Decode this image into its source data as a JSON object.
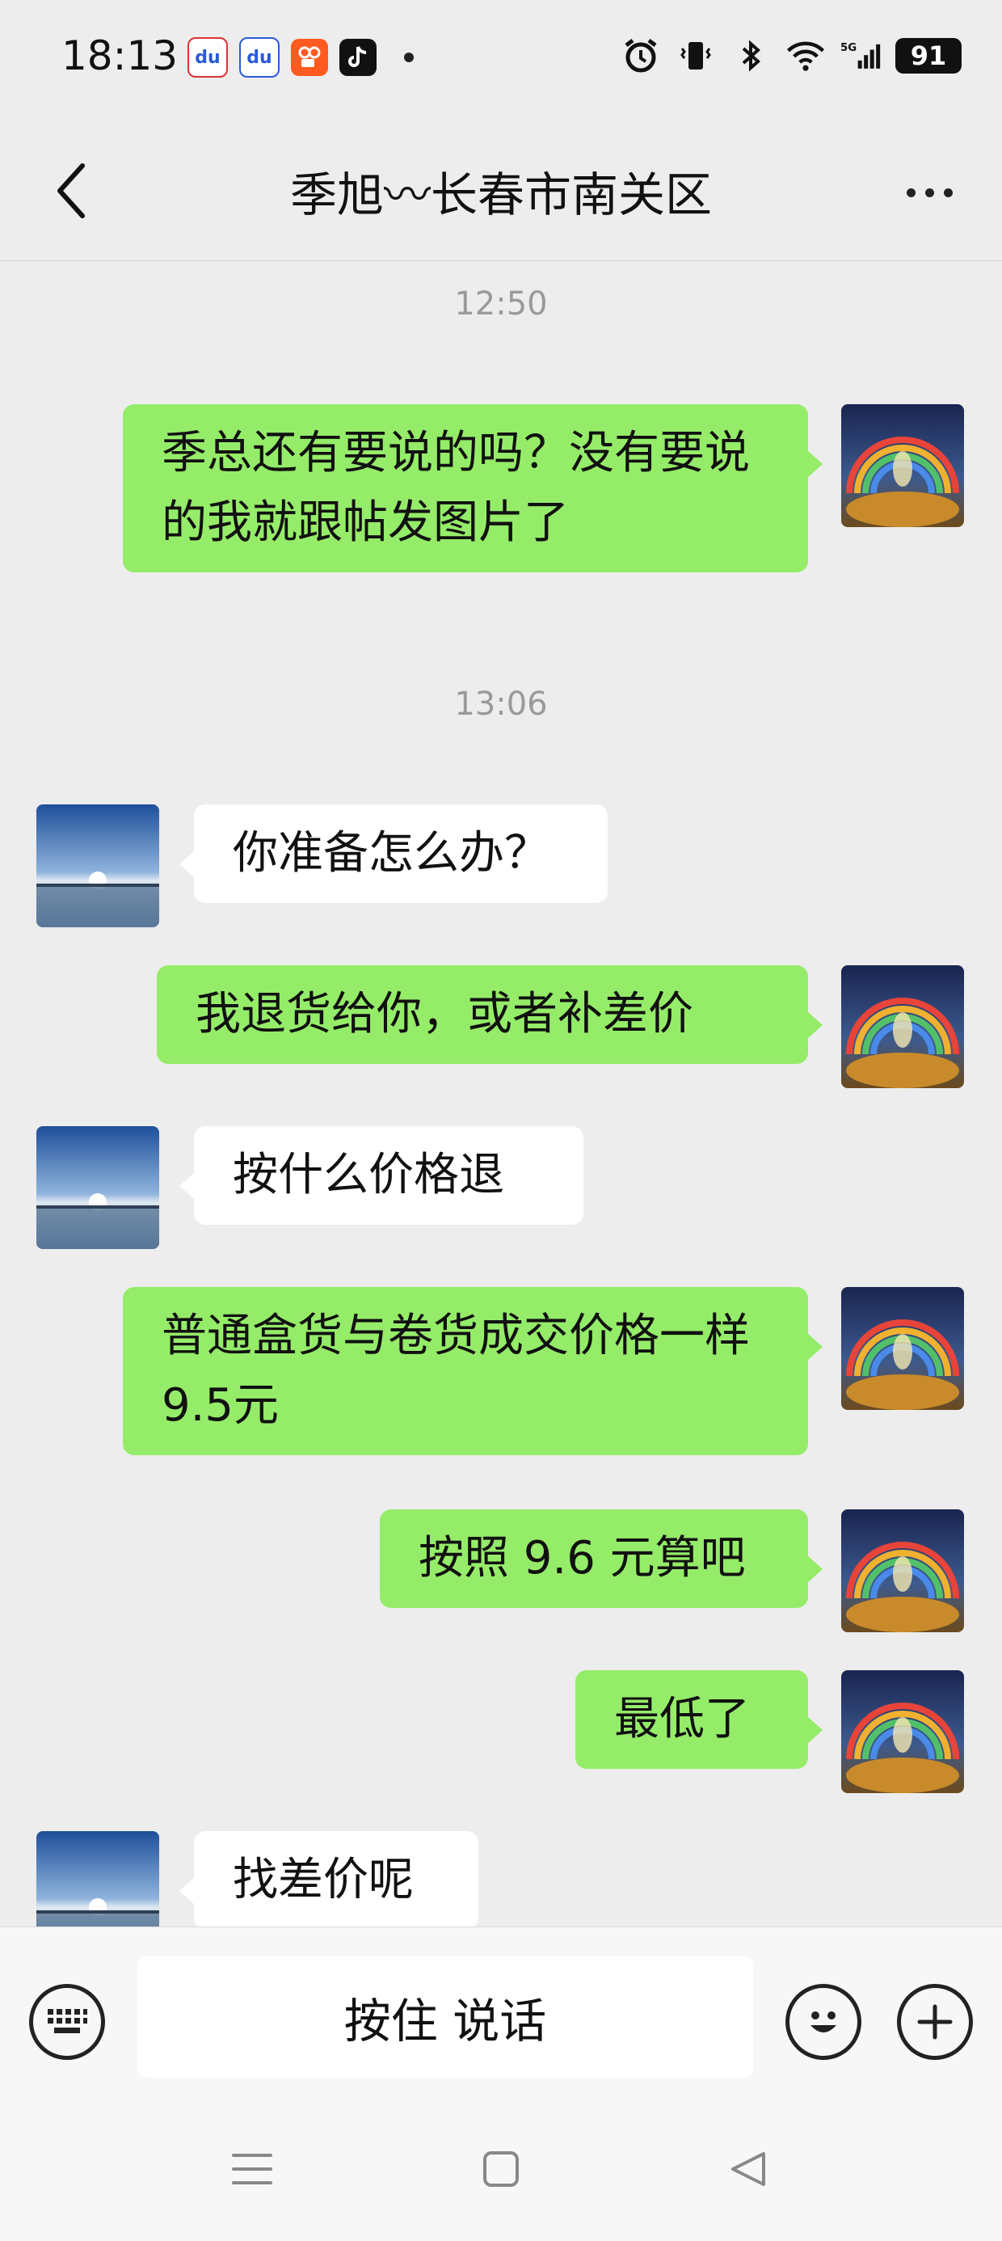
{
  "status_bar": {
    "time": "18:13",
    "network": "5G",
    "battery": "91"
  },
  "header": {
    "title": "季旭〰长春市南关区"
  },
  "messages": [
    {
      "type": "time",
      "text": "12:50"
    },
    {
      "type": "mine",
      "text": "季总还有要说的吗？没有要说的我就跟帖发图片了"
    },
    {
      "type": "time",
      "text": "13:06"
    },
    {
      "type": "theirs",
      "text": "你准备怎么办？"
    },
    {
      "type": "mine",
      "text": "我退货给你，或者补差价"
    },
    {
      "type": "theirs",
      "text": "按什么价格退"
    },
    {
      "type": "mine",
      "text": "普通盒货与卷货成交价格一样 9.5元"
    },
    {
      "type": "mine",
      "text": "按照 9.6 元算吧"
    },
    {
      "type": "mine",
      "text": "最低了"
    },
    {
      "type": "theirs",
      "text": "找差价呢"
    }
  ],
  "input_bar": {
    "talk_label": "按住 说话"
  },
  "colors": {
    "mine_bubble": "#95ec69",
    "theirs_bubble": "#ffffff",
    "background": "#ededed"
  },
  "icons": [
    "keyboard-icon",
    "emoji-icon",
    "plus-icon",
    "back-icon",
    "more-icon",
    "menu-icon",
    "home-icon",
    "nav-back-icon"
  ]
}
